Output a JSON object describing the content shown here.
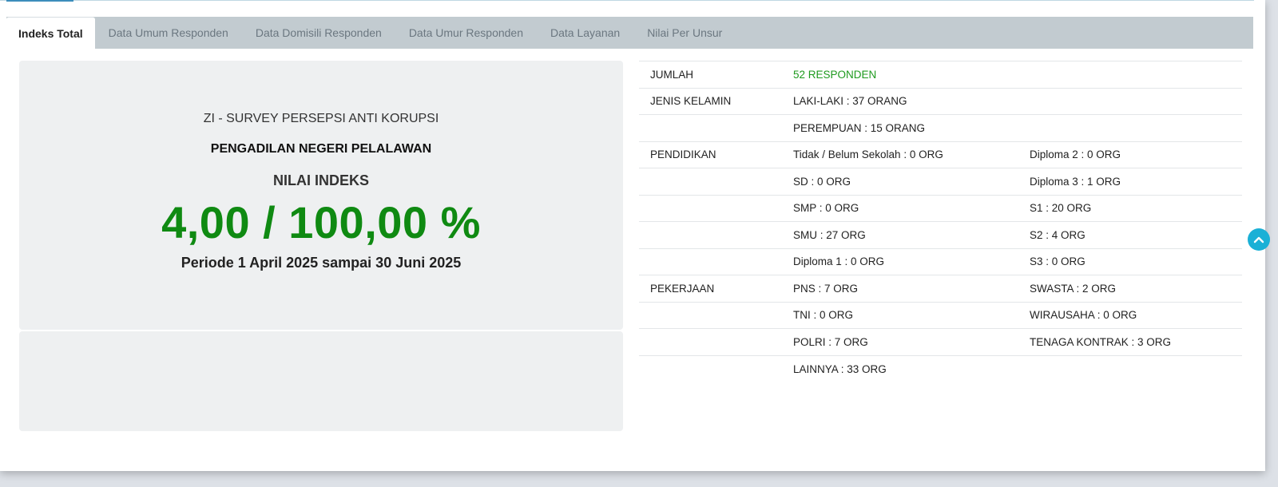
{
  "tabs": [
    {
      "label": "Indeks Total",
      "active": true
    },
    {
      "label": "Data Umum Responden",
      "active": false
    },
    {
      "label": "Data Domisili Responden",
      "active": false
    },
    {
      "label": "Data Umur Responden",
      "active": false
    },
    {
      "label": "Data Layanan",
      "active": false
    },
    {
      "label": "Nilai Per Unsur",
      "active": false
    }
  ],
  "summary": {
    "survey_title": "ZI - SURVEY PERSEPSI ANTI KORUPSI",
    "court_name": "PENGADILAN NEGERI PELALAWAN",
    "index_label": "NILAI INDEKS",
    "index_value": "4,00 / 100,00 %",
    "period": "Periode 1 April 2025 sampai 30 Juni 2025"
  },
  "stats": {
    "rows": [
      {
        "label": "JUMLAH",
        "col1": "52 RESPONDEN",
        "col2": "",
        "highlight": true
      },
      {
        "label": "JENIS KELAMIN",
        "col1": "LAKI-LAKI : 37 ORANG",
        "col2": ""
      },
      {
        "label": "",
        "col1": "PEREMPUAN : 15 ORANG",
        "col2": ""
      },
      {
        "label": "PENDIDIKAN",
        "col1": "Tidak / Belum Sekolah : 0 ORG",
        "col2": "Diploma 2 : 0 ORG"
      },
      {
        "label": "",
        "col1": "SD : 0 ORG",
        "col2": "Diploma 3 : 1 ORG"
      },
      {
        "label": "",
        "col1": "SMP : 0 ORG",
        "col2": "S1 : 20 ORG"
      },
      {
        "label": "",
        "col1": "SMU : 27 ORG",
        "col2": "S2 : 4 ORG"
      },
      {
        "label": "",
        "col1": "Diploma 1 : 0 ORG",
        "col2": "S3 : 0 ORG"
      },
      {
        "label": "PEKERJAAN",
        "col1": "PNS : 7 ORG",
        "col2": "SWASTA : 2 ORG"
      },
      {
        "label": "",
        "col1": "TNI : 0 ORG",
        "col2": "WIRAUSAHA : 0 ORG"
      },
      {
        "label": "",
        "col1": "POLRI : 7 ORG",
        "col2": "TENAGA KONTRAK : 3 ORG"
      },
      {
        "label": "",
        "col1": "LAINNYA : 33 ORG",
        "col2": ""
      }
    ]
  },
  "scroll_top": {
    "icon": "chevron-up-icon"
  },
  "colors": {
    "index_green": "#0f8a12",
    "responden_green": "#1e9a1e",
    "tabbar_bg": "#c2cbd0",
    "scroll_button": "#1ab0d6"
  }
}
